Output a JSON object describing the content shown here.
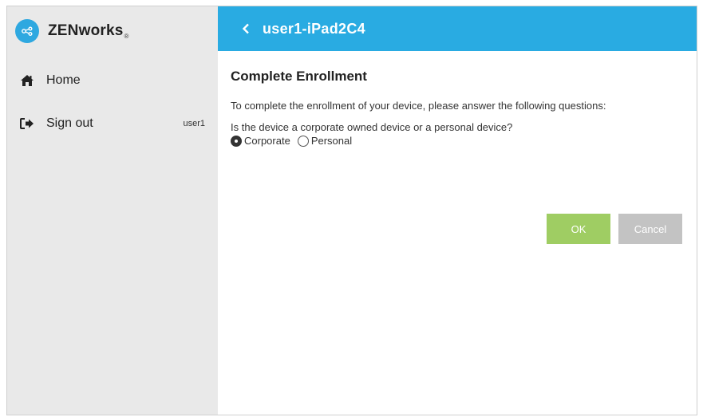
{
  "brand": {
    "name": "ZENworks",
    "mark": "®"
  },
  "nav": {
    "items": [
      {
        "label": "Home",
        "icon": "home-icon"
      },
      {
        "label": "Sign out",
        "icon": "sign-out-icon",
        "user": "user1"
      }
    ]
  },
  "header": {
    "back_icon": "chevron-left-icon",
    "title": "user1-iPad2C4"
  },
  "form": {
    "heading": "Complete Enrollment",
    "intro": "To complete the enrollment of your device, please answer the following questions:",
    "question": "Is the device a corporate owned device or a personal device?",
    "options": [
      {
        "label": "Corporate",
        "selected": true
      },
      {
        "label": "Personal",
        "selected": false
      }
    ],
    "ok_label": "OK",
    "cancel_label": "Cancel"
  },
  "colors": {
    "header_bg": "#29abe2",
    "sidebar_bg": "#e9e9e9",
    "ok_bg": "#9fcd63",
    "cancel_bg": "#c3c3c3",
    "logo_bg": "#2ea8e0"
  }
}
